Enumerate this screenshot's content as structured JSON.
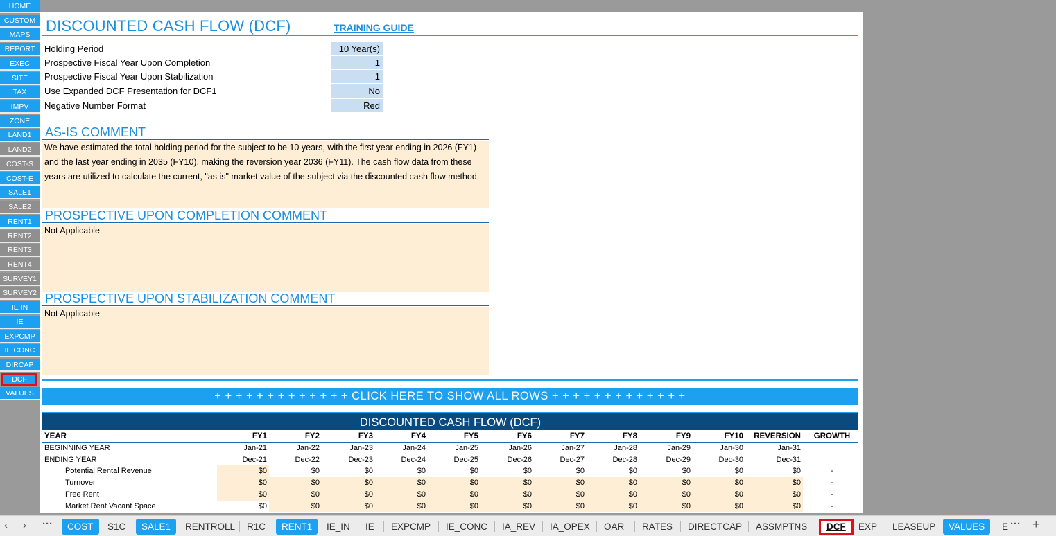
{
  "left_nav": [
    {
      "label": "HOME",
      "style": "blue"
    },
    {
      "label": "CUSTOM",
      "style": "blue"
    },
    {
      "label": "MAPS",
      "style": "blue"
    },
    {
      "label": "REPORT",
      "style": "blue"
    },
    {
      "label": "EXEC",
      "style": "blue"
    },
    {
      "label": "SITE",
      "style": "blue"
    },
    {
      "label": "TAX",
      "style": "blue"
    },
    {
      "label": "IMPV",
      "style": "blue"
    },
    {
      "label": "ZONE",
      "style": "blue"
    },
    {
      "label": "LAND1",
      "style": "blue"
    },
    {
      "label": "LAND2",
      "style": "gray"
    },
    {
      "label": "COST-S",
      "style": "gray"
    },
    {
      "label": "COST-E",
      "style": "blue"
    },
    {
      "label": "SALE1",
      "style": "blue"
    },
    {
      "label": "SALE2",
      "style": "gray"
    },
    {
      "label": "RENT1",
      "style": "blue"
    },
    {
      "label": "RENT2",
      "style": "gray"
    },
    {
      "label": "RENT3",
      "style": "gray"
    },
    {
      "label": "RENT4",
      "style": "gray"
    },
    {
      "label": "SURVEY1",
      "style": "gray"
    },
    {
      "label": "SURVEY2",
      "style": "gray"
    },
    {
      "label": "IE IN",
      "style": "blue"
    },
    {
      "label": "IE",
      "style": "blue"
    },
    {
      "label": "EXPCMP",
      "style": "blue"
    },
    {
      "label": "IE CONC",
      "style": "blue"
    },
    {
      "label": "DIRCAP",
      "style": "blue"
    },
    {
      "label": "DCF",
      "style": "active"
    },
    {
      "label": "VALUES",
      "style": "blue"
    }
  ],
  "header": {
    "title": "DISCOUNTED CASH FLOW (DCF)",
    "training_link": "TRAINING GUIDE"
  },
  "settings": [
    {
      "label": "Holding Period",
      "value": "10 Year(s)"
    },
    {
      "label": "Prospective Fiscal Year Upon Completion",
      "value": "1"
    },
    {
      "label": "Prospective Fiscal Year Upon Stabilization",
      "value": "1"
    },
    {
      "label": "Use Expanded DCF Presentation for DCF1",
      "value": "No"
    },
    {
      "label": "Negative Number Format",
      "value": "Red"
    }
  ],
  "comments": {
    "as_is_title": "AS-IS COMMENT",
    "as_is_text": "We have estimated the total holding period for the subject to be 10 years, with the first year ending in 2026 (FY1) and the last year ending in 2035 (FY10), making the reversion year 2036 (FY11). The cash flow data from these years are utilized to calculate the current, \"as is\" market value of the subject via the discounted cash flow method.",
    "completion_title": "PROSPECTIVE UPON COMPLETION COMMENT",
    "completion_text": "Not Applicable",
    "stabilization_title": "PROSPECTIVE UPON STABILIZATION COMMENT",
    "stabilization_text": "Not Applicable"
  },
  "show_rows_button": "+ + + + + + + + + + + + + CLICK HERE TO SHOW ALL ROWS + + + + + + + + + + + + +",
  "dcf": {
    "title": "DISCOUNTED CASH FLOW (DCF)",
    "year_label": "YEAR",
    "columns": [
      "FY1",
      "FY2",
      "FY3",
      "FY4",
      "FY5",
      "FY6",
      "FY7",
      "FY8",
      "FY9",
      "FY10",
      "REVERSION"
    ],
    "growth_label": "GROWTH",
    "beginning_label": "BEGINNING YEAR",
    "beginning": [
      "Jan-21",
      "Jan-22",
      "Jan-23",
      "Jan-24",
      "Jan-25",
      "Jan-26",
      "Jan-27",
      "Jan-28",
      "Jan-29",
      "Jan-30",
      "Jan-31"
    ],
    "ending_label": "ENDING YEAR",
    "ending": [
      "Dec-21",
      "Dec-22",
      "Dec-23",
      "Dec-24",
      "Dec-25",
      "Dec-26",
      "Dec-27",
      "Dec-28",
      "Dec-29",
      "Dec-30",
      "Dec-31"
    ],
    "rows": [
      {
        "label": "Potential Rental Revenue",
        "values": [
          "$0",
          "$0",
          "$0",
          "$0",
          "$0",
          "$0",
          "$0",
          "$0",
          "$0",
          "$0",
          "$0"
        ],
        "growth": "-"
      },
      {
        "label": "Turnover",
        "values": [
          "$0",
          "$0",
          "$0",
          "$0",
          "$0",
          "$0",
          "$0",
          "$0",
          "$0",
          "$0",
          "$0"
        ],
        "growth": "-"
      },
      {
        "label": "Free Rent",
        "values": [
          "$0",
          "$0",
          "$0",
          "$0",
          "$0",
          "$0",
          "$0",
          "$0",
          "$0",
          "$0",
          "$0"
        ],
        "growth": "-"
      },
      {
        "label": "Market Rent Vacant Space",
        "values": [
          "$0",
          "$0",
          "$0",
          "$0",
          "$0",
          "$0",
          "$0",
          "$0",
          "$0",
          "$0",
          "$0"
        ],
        "growth": "-"
      }
    ]
  },
  "tabbar": {
    "prev": "‹",
    "next": "›",
    "more_left": "···",
    "more_right": "···",
    "add": "+",
    "tabs": [
      {
        "label": "COST",
        "style": "blue"
      },
      {
        "label": "S1C",
        "style": "plain"
      },
      {
        "label": "SALE1",
        "style": "blue"
      },
      {
        "label": "RENTROLL",
        "style": "plain"
      },
      {
        "label": "R1C",
        "style": "plain"
      },
      {
        "label": "RENT1",
        "style": "blue"
      },
      {
        "label": "IE_IN",
        "style": "plain"
      },
      {
        "label": "IE",
        "style": "plain"
      },
      {
        "label": "EXPCMP",
        "style": "plain"
      },
      {
        "label": "IE_CONC",
        "style": "plain"
      },
      {
        "label": "IA_REV",
        "style": "plain"
      },
      {
        "label": "IA_OPEX",
        "style": "plain"
      },
      {
        "label": "OAR",
        "style": "plain"
      },
      {
        "label": "RATES",
        "style": "plain"
      },
      {
        "label": "DIRECTCAP",
        "style": "plain"
      },
      {
        "label": "ASSMPTNS",
        "style": "plain"
      },
      {
        "label": "DCF",
        "style": "active"
      },
      {
        "label": "EXP",
        "style": "plain"
      },
      {
        "label": "LEASEUP",
        "style": "plain"
      },
      {
        "label": "VALUES",
        "style": "blue"
      },
      {
        "label": "E",
        "style": "plain"
      }
    ]
  },
  "colors": {
    "accent_blue": "#1ea0f0",
    "dark_blue": "#0b4a7e",
    "input_blue": "#c9dff1",
    "comment_tan": "#fdeed5",
    "active_red": "#e0101a"
  }
}
